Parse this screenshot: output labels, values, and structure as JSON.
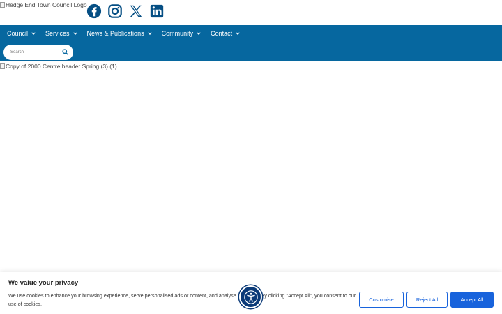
{
  "header": {
    "logo_alt": "Hedge End Town Council Logo",
    "social_icons": [
      "facebook-icon",
      "instagram-icon",
      "x-twitter-icon",
      "linkedin-icon"
    ]
  },
  "nav": {
    "items": [
      {
        "label": "Council"
      },
      {
        "label": "Services"
      },
      {
        "label": "News & Publications"
      },
      {
        "label": "Community"
      },
      {
        "label": "Contact"
      }
    ],
    "search_placeholder": "Search"
  },
  "hero": {
    "image_alt": "Copy of 2000 Centre header Spring (3) (1)"
  },
  "cookie_banner": {
    "title": "We value your privacy",
    "text": "We use cookies to enhance your browsing experience, serve personalised ads or content, and analyse our traffic. By clicking \"Accept All\", you consent to our use of cookies.",
    "customise_label": "Customise",
    "reject_label": "Reject All",
    "accept_label": "Accept All"
  },
  "colors": {
    "nav_bg": "#06679f",
    "social_icon": "#064f84",
    "cookie_button": "#1863dc",
    "accessibility_button": "#0b3a78"
  }
}
